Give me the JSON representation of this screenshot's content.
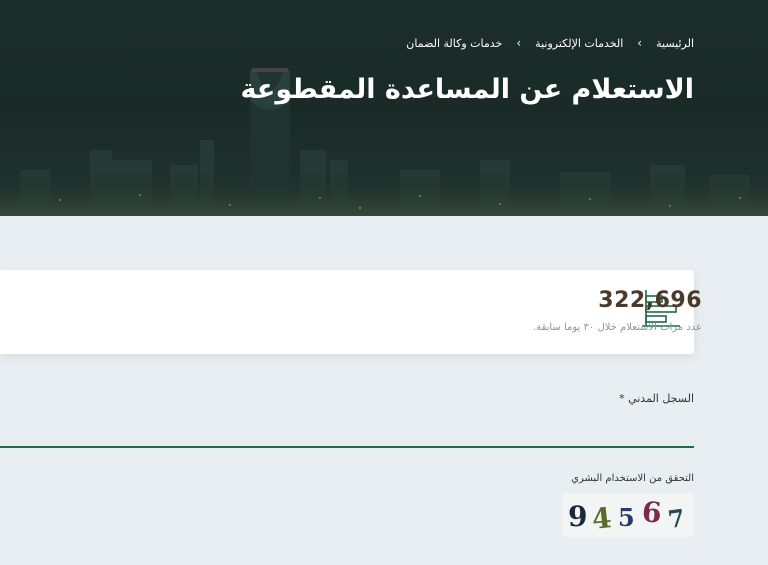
{
  "breadcrumb": {
    "home": "الرئيسية",
    "eservices": "الخدمات الإلكترونية",
    "current": "خدمات وكالة الضمان"
  },
  "page": {
    "title": "الاستعلام عن المساعدة المقطوعة"
  },
  "stats": {
    "count": "322,696",
    "caption": "عدد مرات الاستعلام خلال ٣٠ يوما سابقة.",
    "icon": "bar-chart-icon"
  },
  "form": {
    "civil_label": "السجل المدني *",
    "civil_value": "",
    "captcha_label": "التحقق من الاستخدام البشري",
    "captcha_digits": [
      "9",
      "4",
      "5",
      "6",
      "7"
    ]
  },
  "colors": {
    "accent_green": "#1f6b43",
    "stat_number": "#4a3a2a",
    "hero_bg": "#1c2e2a"
  }
}
